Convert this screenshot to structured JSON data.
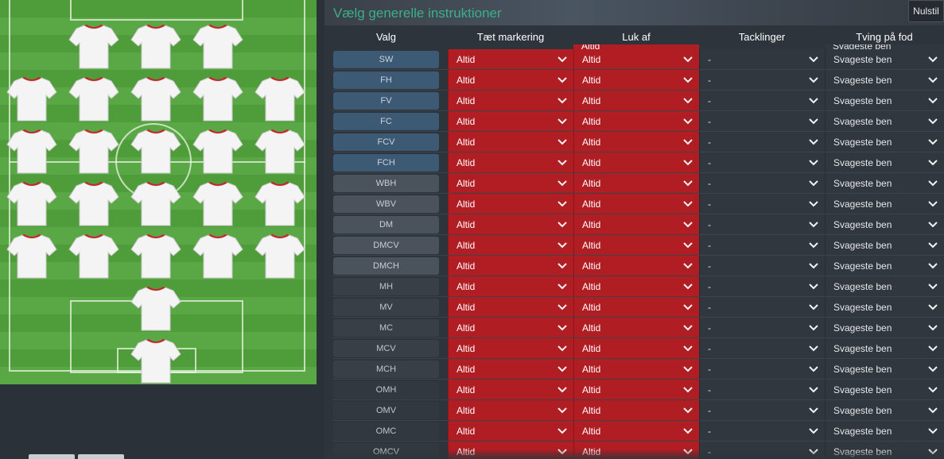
{
  "panel": {
    "title": "Vælg generelle instruktioner",
    "reset_label": "Nulstil"
  },
  "columns": [
    "Valg",
    "Tæt markering",
    "Luk af",
    "Tacklinger",
    "Tving på fod"
  ],
  "partial_top": {
    "luk_af": "Altid",
    "tving": "Svageste ben"
  },
  "rows": [
    {
      "pos": "SW",
      "style": "blue",
      "marking": "Altid",
      "closing": "Altid",
      "tackling": "-",
      "foot": "Svageste ben"
    },
    {
      "pos": "FH",
      "style": "blue",
      "marking": "Altid",
      "closing": "Altid",
      "tackling": "-",
      "foot": "Svageste ben"
    },
    {
      "pos": "FV",
      "style": "blue",
      "marking": "Altid",
      "closing": "Altid",
      "tackling": "-",
      "foot": "Svageste ben"
    },
    {
      "pos": "FC",
      "style": "blue",
      "marking": "Altid",
      "closing": "Altid",
      "tackling": "-",
      "foot": "Svageste ben"
    },
    {
      "pos": "FCV",
      "style": "blue",
      "marking": "Altid",
      "closing": "Altid",
      "tackling": "-",
      "foot": "Svageste ben"
    },
    {
      "pos": "FCH",
      "style": "blue",
      "marking": "Altid",
      "closing": "Altid",
      "tackling": "-",
      "foot": "Svageste ben"
    },
    {
      "pos": "WBH",
      "style": "grey",
      "marking": "Altid",
      "closing": "Altid",
      "tackling": "-",
      "foot": "Svageste ben"
    },
    {
      "pos": "WBV",
      "style": "grey",
      "marking": "Altid",
      "closing": "Altid",
      "tackling": "-",
      "foot": "Svageste ben"
    },
    {
      "pos": "DM",
      "style": "grey",
      "marking": "Altid",
      "closing": "Altid",
      "tackling": "-",
      "foot": "Svageste ben"
    },
    {
      "pos": "DMCV",
      "style": "grey",
      "marking": "Altid",
      "closing": "Altid",
      "tackling": "-",
      "foot": "Svageste ben"
    },
    {
      "pos": "DMCH",
      "style": "grey",
      "marking": "Altid",
      "closing": "Altid",
      "tackling": "-",
      "foot": "Svageste ben"
    },
    {
      "pos": "MH",
      "style": "dark",
      "marking": "Altid",
      "closing": "Altid",
      "tackling": "-",
      "foot": "Svageste ben"
    },
    {
      "pos": "MV",
      "style": "dark",
      "marking": "Altid",
      "closing": "Altid",
      "tackling": "-",
      "foot": "Svageste ben"
    },
    {
      "pos": "MC",
      "style": "dark",
      "marking": "Altid",
      "closing": "Altid",
      "tackling": "-",
      "foot": "Svageste ben"
    },
    {
      "pos": "MCV",
      "style": "dark",
      "marking": "Altid",
      "closing": "Altid",
      "tackling": "-",
      "foot": "Svageste ben"
    },
    {
      "pos": "MCH",
      "style": "dark",
      "marking": "Altid",
      "closing": "Altid",
      "tackling": "-",
      "foot": "Svageste ben"
    },
    {
      "pos": "OMH",
      "style": "darker",
      "marking": "Altid",
      "closing": "Altid",
      "tackling": "-",
      "foot": "Svageste ben"
    },
    {
      "pos": "OMV",
      "style": "darker",
      "marking": "Altid",
      "closing": "Altid",
      "tackling": "-",
      "foot": "Svageste ben"
    },
    {
      "pos": "OMC",
      "style": "darker",
      "marking": "Altid",
      "closing": "Altid",
      "tackling": "-",
      "foot": "Svageste ben"
    },
    {
      "pos": "OMCV",
      "style": "darker",
      "marking": "Altid",
      "closing": "Altid",
      "tackling": "-",
      "foot": "Svageste ben"
    }
  ],
  "colors": {
    "title_green": "#3ab08a",
    "dropdown_red": "#b01d23",
    "position_blue": "#3d5a75",
    "pitch_green": "#5aa845"
  },
  "icons": {
    "dropdown": "chevron-down-icon",
    "player": "shirt-icon"
  }
}
